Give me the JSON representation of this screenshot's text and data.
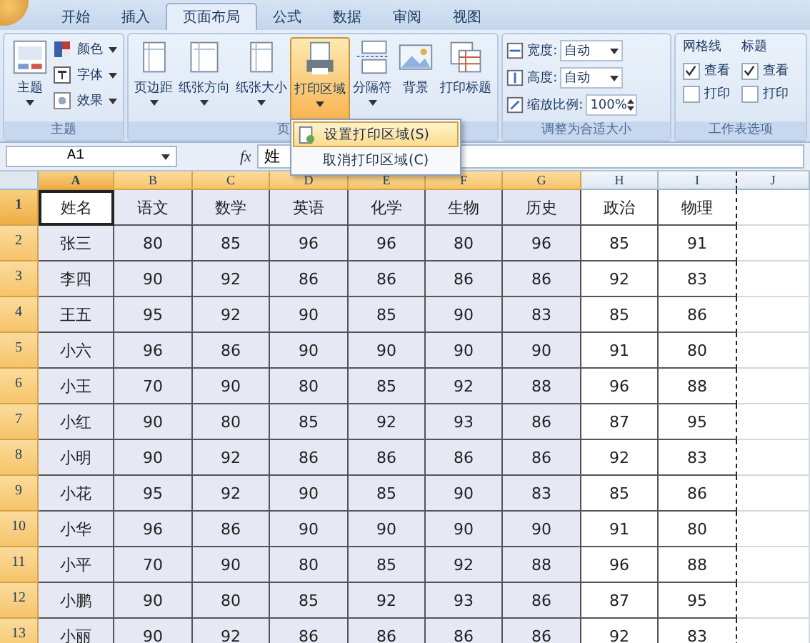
{
  "tabs": [
    {
      "label": "开始",
      "selected": false
    },
    {
      "label": "插入",
      "selected": false
    },
    {
      "label": "页面布局",
      "selected": true
    },
    {
      "label": "公式",
      "selected": false
    },
    {
      "label": "数据",
      "selected": false
    },
    {
      "label": "审阅",
      "selected": false
    },
    {
      "label": "视图",
      "selected": false
    }
  ],
  "theme_group": {
    "label": "主题",
    "button": "主题",
    "options": [
      "颜色",
      "字体",
      "效果"
    ]
  },
  "page_setup_group": {
    "label": "页",
    "buttons": [
      {
        "label": "页边距",
        "dropdown": true,
        "pressed": false
      },
      {
        "label": "纸张方向",
        "dropdown": true,
        "pressed": false
      },
      {
        "label": "纸张大小",
        "dropdown": true,
        "pressed": false
      },
      {
        "label": "打印区域",
        "dropdown": true,
        "pressed": true
      },
      {
        "label": "分隔符",
        "dropdown": true,
        "pressed": false
      },
      {
        "label": "背景",
        "dropdown": false,
        "pressed": false
      },
      {
        "label": "打印标题",
        "dropdown": false,
        "pressed": false
      }
    ]
  },
  "scale_group": {
    "label": "调整为合适大小",
    "fields": [
      {
        "label": "宽度:",
        "value": "自动",
        "kind": "dropdown"
      },
      {
        "label": "高度:",
        "value": "自动",
        "kind": "dropdown"
      },
      {
        "label": "缩放比例:",
        "value": "100%",
        "kind": "spinner"
      }
    ]
  },
  "sheet_options_group": {
    "label": "工作表选项",
    "sections": [
      {
        "title": "网格线",
        "options": [
          {
            "label": "查看",
            "checked": true
          },
          {
            "label": "打印",
            "checked": false
          }
        ]
      },
      {
        "title": "标题",
        "options": [
          {
            "label": "查看",
            "checked": true
          },
          {
            "label": "打印",
            "checked": false
          }
        ]
      }
    ]
  },
  "menu": {
    "items": [
      {
        "label": "设置打印区域(S)",
        "selected": true
      },
      {
        "label": "取消打印区域(C)",
        "selected": false
      }
    ]
  },
  "formula_bar": {
    "name_box": "A1",
    "function_label": "fx",
    "content": "姓"
  },
  "sheet": {
    "columns": [
      {
        "label": "A",
        "selected": true,
        "active": true,
        "page_break_after": false
      },
      {
        "label": "B",
        "selected": true,
        "active": false,
        "page_break_after": false
      },
      {
        "label": "C",
        "selected": true,
        "active": false,
        "page_break_after": false
      },
      {
        "label": "D",
        "selected": true,
        "active": false,
        "page_break_after": false
      },
      {
        "label": "E",
        "selected": true,
        "active": false,
        "page_break_after": false
      },
      {
        "label": "F",
        "selected": true,
        "active": false,
        "page_break_after": false
      },
      {
        "label": "G",
        "selected": true,
        "active": false,
        "page_break_after": false
      },
      {
        "label": "H",
        "selected": false,
        "active": false,
        "page_break_after": false
      },
      {
        "label": "I",
        "selected": false,
        "active": false,
        "page_break_after": true
      },
      {
        "label": "J",
        "selected": false,
        "active": false,
        "page_break_after": false
      }
    ],
    "rows": [
      {
        "number": "1",
        "selected": true,
        "active": true,
        "cells": [
          "姓名",
          "语文",
          "数学",
          "英语",
          "化学",
          "生物",
          "历史",
          "政治",
          "物理"
        ]
      },
      {
        "number": "2",
        "selected": true,
        "active": false,
        "cells": [
          "张三",
          "80",
          "85",
          "96",
          "96",
          "80",
          "96",
          "85",
          "91"
        ]
      },
      {
        "number": "3",
        "selected": true,
        "active": false,
        "cells": [
          "李四",
          "90",
          "92",
          "86",
          "86",
          "86",
          "86",
          "92",
          "83"
        ]
      },
      {
        "number": "4",
        "selected": true,
        "active": false,
        "cells": [
          "王五",
          "95",
          "92",
          "90",
          "85",
          "90",
          "83",
          "85",
          "86"
        ]
      },
      {
        "number": "5",
        "selected": true,
        "active": false,
        "cells": [
          "小六",
          "96",
          "86",
          "90",
          "90",
          "90",
          "90",
          "91",
          "80"
        ]
      },
      {
        "number": "6",
        "selected": true,
        "active": false,
        "cells": [
          "小王",
          "70",
          "90",
          "80",
          "85",
          "92",
          "88",
          "96",
          "88"
        ]
      },
      {
        "number": "7",
        "selected": true,
        "active": false,
        "cells": [
          "小红",
          "90",
          "80",
          "85",
          "92",
          "93",
          "86",
          "87",
          "95"
        ]
      },
      {
        "number": "8",
        "selected": true,
        "active": false,
        "cells": [
          "小明",
          "90",
          "92",
          "86",
          "86",
          "86",
          "86",
          "92",
          "83"
        ]
      },
      {
        "number": "9",
        "selected": true,
        "active": false,
        "cells": [
          "小花",
          "95",
          "92",
          "90",
          "85",
          "90",
          "83",
          "85",
          "86"
        ]
      },
      {
        "number": "10",
        "selected": true,
        "active": false,
        "cells": [
          "小华",
          "96",
          "86",
          "90",
          "90",
          "90",
          "90",
          "91",
          "80"
        ]
      },
      {
        "number": "11",
        "selected": true,
        "active": false,
        "cells": [
          "小平",
          "70",
          "90",
          "80",
          "85",
          "92",
          "88",
          "96",
          "88"
        ]
      },
      {
        "number": "12",
        "selected": true,
        "active": false,
        "cells": [
          "小鹏",
          "90",
          "80",
          "85",
          "92",
          "93",
          "86",
          "87",
          "95"
        ]
      },
      {
        "number": "13",
        "selected": true,
        "active": false,
        "cells": [
          "小丽",
          "90",
          "92",
          "86",
          "86",
          "86",
          "86",
          "92",
          "83"
        ]
      }
    ]
  }
}
